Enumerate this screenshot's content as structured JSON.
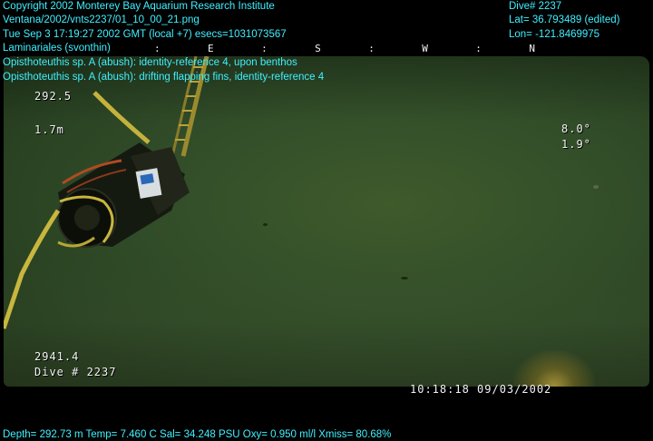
{
  "header": {
    "line1": "Copyright 2002 Monterey Bay Aquarium Research Institute",
    "line2": "Ventana/2002/vnts2237/01_10_00_21.png",
    "line3": "Tue Sep  3 17:19:27 2002 GMT (local +7)  esecs=1031073567",
    "line4": "Laminariales (svonthin)",
    "line5": "Opisthoteuthis sp. A (abush): identity-reference 4, upon benthos",
    "line6": "Opisthoteuthis sp. A (abush): drifting flapping fins, identity-reference 4"
  },
  "dive_info": {
    "dive": "Dive# 2237",
    "lat": "Lat= 36.793489 (edited)",
    "lon": "Lon= -121.8469975"
  },
  "compass": {
    "ticks": [
      ":",
      "E",
      ":",
      "S",
      ":",
      "W",
      ":",
      "N"
    ]
  },
  "video_overlay": {
    "heading": "292.5",
    "altitude": "1.7m",
    "pitch": "8.0°",
    "roll": "1.9°",
    "depth_readout": "2941.4",
    "dive_label": "Dive # 2237",
    "timestamp": "10:18:18 09/03/2002"
  },
  "footer": {
    "sensors": "Depth= 292.73 m  Temp= 7.460 C  Sal= 34.248 PSU  Oxy= 0.950 ml/l  Xmiss= 80.68%"
  },
  "colors": {
    "overlay_cyan": "#3ff0ff",
    "overlay_white": "#f4f4f4",
    "water": "#34502a"
  }
}
